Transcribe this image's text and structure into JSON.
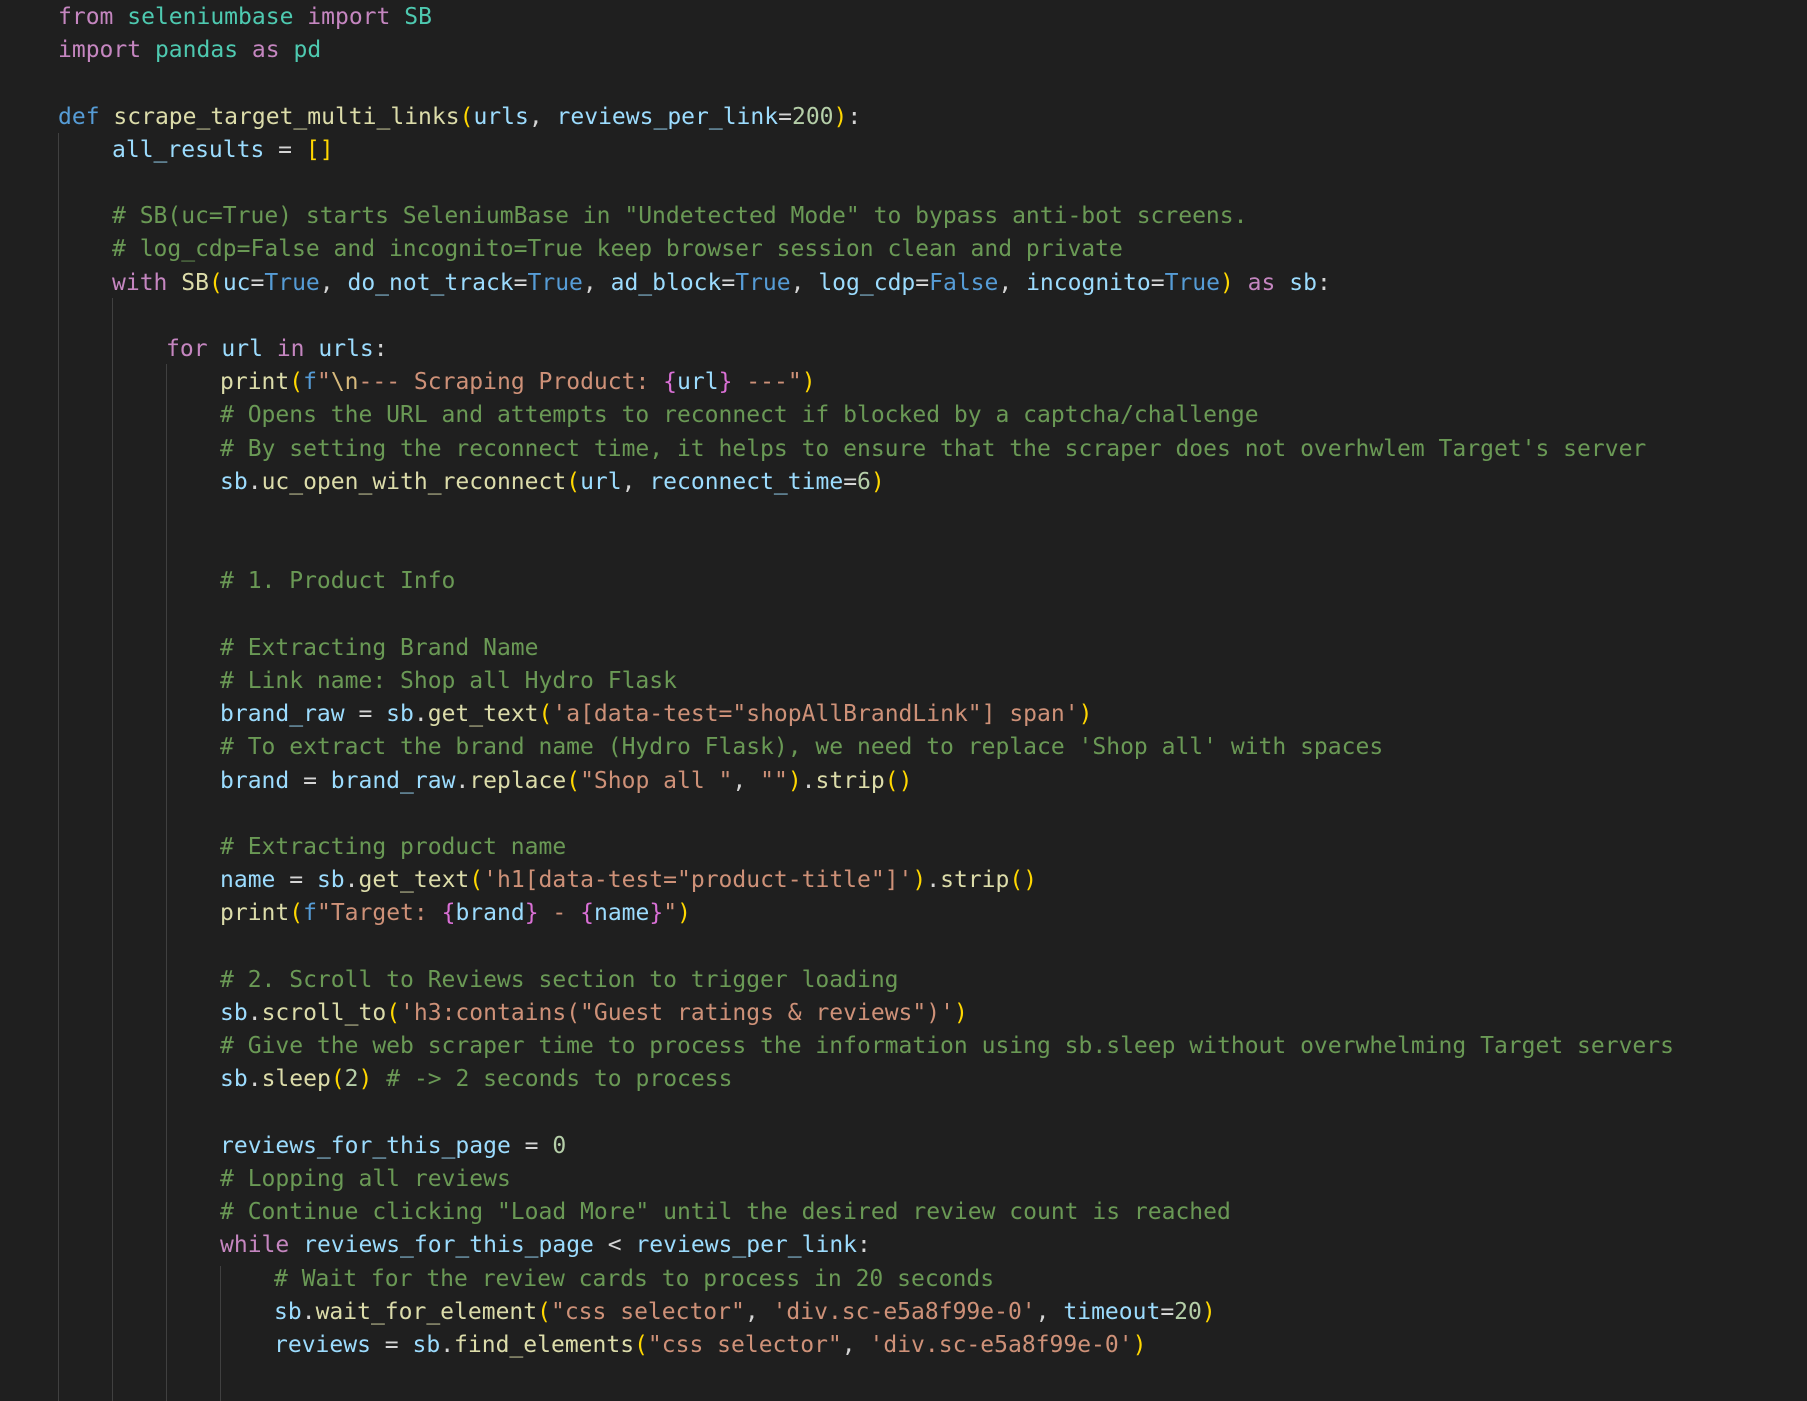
{
  "colors": {
    "background": "#1f1f1f",
    "keyword": "#c586c0",
    "storage": "#569cd6",
    "type": "#4ec9b0",
    "function": "#dcdcaa",
    "variable": "#9cdcfe",
    "string": "#ce9178",
    "number": "#b5cea8",
    "comment": "#6a9955",
    "operator": "#d4d4d4",
    "bracket_1": "#ffd700",
    "bracket_2": "#da70d6",
    "bracket_3": "#179fff",
    "escape": "#d7ba7d"
  },
  "code_lines": [
    {
      "indent": 0,
      "tokens": [
        [
          "kw",
          "from"
        ],
        [
          "op",
          " "
        ],
        [
          "cls",
          "seleniumbase"
        ],
        [
          "op",
          " "
        ],
        [
          "kw",
          "import"
        ],
        [
          "op",
          " "
        ],
        [
          "cls",
          "SB"
        ]
      ]
    },
    {
      "indent": 0,
      "tokens": [
        [
          "kw",
          "import"
        ],
        [
          "op",
          " "
        ],
        [
          "cls",
          "pandas"
        ],
        [
          "op",
          " "
        ],
        [
          "kw",
          "as"
        ],
        [
          "op",
          " "
        ],
        [
          "cls",
          "pd"
        ]
      ]
    },
    {
      "indent": 0,
      "tokens": []
    },
    {
      "indent": 0,
      "tokens": [
        [
          "def",
          "def"
        ],
        [
          "op",
          " "
        ],
        [
          "fn",
          "scrape_target_multi_links"
        ],
        [
          "b1",
          "("
        ],
        [
          "var",
          "urls"
        ],
        [
          "op",
          ", "
        ],
        [
          "var",
          "reviews_per_link"
        ],
        [
          "op",
          "="
        ],
        [
          "num",
          "200"
        ],
        [
          "b1",
          ")"
        ],
        [
          "op",
          ":"
        ]
      ]
    },
    {
      "indent": 1,
      "tokens": [
        [
          "var",
          "all_results"
        ],
        [
          "op",
          " = "
        ],
        [
          "b1",
          "[]"
        ]
      ]
    },
    {
      "indent": 0,
      "tokens": []
    },
    {
      "indent": 1,
      "tokens": [
        [
          "cmt",
          "# SB(uc=True) starts SeleniumBase in \"Undetected Mode\" to bypass anti-bot screens."
        ]
      ]
    },
    {
      "indent": 1,
      "tokens": [
        [
          "cmt",
          "# log_cdp=False and incognito=True keep browser session clean and private"
        ]
      ]
    },
    {
      "indent": 1,
      "tokens": [
        [
          "kw",
          "with"
        ],
        [
          "op",
          " "
        ],
        [
          "fn",
          "SB"
        ],
        [
          "b1",
          "("
        ],
        [
          "var",
          "uc"
        ],
        [
          "op",
          "="
        ],
        [
          "def",
          "True"
        ],
        [
          "op",
          ", "
        ],
        [
          "var",
          "do_not_track"
        ],
        [
          "op",
          "="
        ],
        [
          "def",
          "True"
        ],
        [
          "op",
          ", "
        ],
        [
          "var",
          "ad_block"
        ],
        [
          "op",
          "="
        ],
        [
          "def",
          "True"
        ],
        [
          "op",
          ", "
        ],
        [
          "var",
          "log_cdp"
        ],
        [
          "op",
          "="
        ],
        [
          "def",
          "False"
        ],
        [
          "op",
          ", "
        ],
        [
          "var",
          "incognito"
        ],
        [
          "op",
          "="
        ],
        [
          "def",
          "True"
        ],
        [
          "b1",
          ")"
        ],
        [
          "op",
          " "
        ],
        [
          "kw",
          "as"
        ],
        [
          "op",
          " "
        ],
        [
          "var",
          "sb"
        ],
        [
          "op",
          ":"
        ]
      ]
    },
    {
      "indent": 0,
      "tokens": []
    },
    {
      "indent": 2,
      "tokens": [
        [
          "kw",
          "for"
        ],
        [
          "op",
          " "
        ],
        [
          "var",
          "url"
        ],
        [
          "op",
          " "
        ],
        [
          "kw",
          "in"
        ],
        [
          "op",
          " "
        ],
        [
          "var",
          "urls"
        ],
        [
          "op",
          ":"
        ]
      ]
    },
    {
      "indent": 3,
      "tokens": [
        [
          "fn",
          "print"
        ],
        [
          "b1",
          "("
        ],
        [
          "def",
          "f"
        ],
        [
          "str",
          "\""
        ],
        [
          "esc",
          "\\n"
        ],
        [
          "str",
          "--- Scraping Product: "
        ],
        [
          "b2",
          "{"
        ],
        [
          "var",
          "url"
        ],
        [
          "b2",
          "}"
        ],
        [
          "str",
          " ---\""
        ],
        [
          "b1",
          ")"
        ]
      ]
    },
    {
      "indent": 3,
      "tokens": [
        [
          "cmt",
          "# Opens the URL and attempts to reconnect if blocked by a captcha/challenge"
        ]
      ]
    },
    {
      "indent": 3,
      "tokens": [
        [
          "cmt",
          "# By setting the reconnect time, it helps to ensure that the scraper does not overhwlem Target's server"
        ]
      ]
    },
    {
      "indent": 3,
      "tokens": [
        [
          "var",
          "sb"
        ],
        [
          "op",
          "."
        ],
        [
          "fn",
          "uc_open_with_reconnect"
        ],
        [
          "b1",
          "("
        ],
        [
          "var",
          "url"
        ],
        [
          "op",
          ", "
        ],
        [
          "var",
          "reconnect_time"
        ],
        [
          "op",
          "="
        ],
        [
          "num",
          "6"
        ],
        [
          "b1",
          ")"
        ]
      ]
    },
    {
      "indent": 0,
      "tokens": []
    },
    {
      "indent": 0,
      "tokens": []
    },
    {
      "indent": 3,
      "tokens": [
        [
          "cmt",
          "# 1. Product Info"
        ]
      ]
    },
    {
      "indent": 0,
      "tokens": []
    },
    {
      "indent": 3,
      "tokens": [
        [
          "cmt",
          "# Extracting Brand Name"
        ]
      ]
    },
    {
      "indent": 3,
      "tokens": [
        [
          "cmt",
          "# Link name: Shop all Hydro Flask"
        ]
      ]
    },
    {
      "indent": 3,
      "tokens": [
        [
          "var",
          "brand_raw"
        ],
        [
          "op",
          " = "
        ],
        [
          "var",
          "sb"
        ],
        [
          "op",
          "."
        ],
        [
          "fn",
          "get_text"
        ],
        [
          "b1",
          "("
        ],
        [
          "str",
          "'a[data-test=\"shopAllBrandLink\"] span'"
        ],
        [
          "b1",
          ")"
        ]
      ]
    },
    {
      "indent": 3,
      "tokens": [
        [
          "cmt",
          "# To extract the brand name (Hydro Flask), we need to replace 'Shop all' with spaces"
        ]
      ]
    },
    {
      "indent": 3,
      "tokens": [
        [
          "var",
          "brand"
        ],
        [
          "op",
          " = "
        ],
        [
          "var",
          "brand_raw"
        ],
        [
          "op",
          "."
        ],
        [
          "fn",
          "replace"
        ],
        [
          "b1",
          "("
        ],
        [
          "str",
          "\"Shop all \""
        ],
        [
          "op",
          ", "
        ],
        [
          "str",
          "\"\""
        ],
        [
          "b1",
          ")"
        ],
        [
          "op",
          "."
        ],
        [
          "fn",
          "strip"
        ],
        [
          "b1",
          "()"
        ]
      ]
    },
    {
      "indent": 0,
      "tokens": []
    },
    {
      "indent": 3,
      "tokens": [
        [
          "cmt",
          "# Extracting product name"
        ]
      ]
    },
    {
      "indent": 3,
      "tokens": [
        [
          "var",
          "name"
        ],
        [
          "op",
          " = "
        ],
        [
          "var",
          "sb"
        ],
        [
          "op",
          "."
        ],
        [
          "fn",
          "get_text"
        ],
        [
          "b1",
          "("
        ],
        [
          "str",
          "'h1[data-test=\"product-title\"]'"
        ],
        [
          "b1",
          ")"
        ],
        [
          "op",
          "."
        ],
        [
          "fn",
          "strip"
        ],
        [
          "b1",
          "()"
        ]
      ]
    },
    {
      "indent": 3,
      "tokens": [
        [
          "fn",
          "print"
        ],
        [
          "b1",
          "("
        ],
        [
          "def",
          "f"
        ],
        [
          "str",
          "\"Target: "
        ],
        [
          "b2",
          "{"
        ],
        [
          "var",
          "brand"
        ],
        [
          "b2",
          "}"
        ],
        [
          "str",
          " - "
        ],
        [
          "b2",
          "{"
        ],
        [
          "var",
          "name"
        ],
        [
          "b2",
          "}"
        ],
        [
          "str",
          "\""
        ],
        [
          "b1",
          ")"
        ]
      ]
    },
    {
      "indent": 0,
      "tokens": []
    },
    {
      "indent": 3,
      "tokens": [
        [
          "cmt",
          "# 2. Scroll to Reviews section to trigger loading"
        ]
      ]
    },
    {
      "indent": 3,
      "tokens": [
        [
          "var",
          "sb"
        ],
        [
          "op",
          "."
        ],
        [
          "fn",
          "scroll_to"
        ],
        [
          "b1",
          "("
        ],
        [
          "str",
          "'h3:contains(\"Guest ratings & reviews\")'"
        ],
        [
          "b1",
          ")"
        ]
      ]
    },
    {
      "indent": 3,
      "tokens": [
        [
          "cmt",
          "# Give the web scraper time to process the information using sb.sleep without overwhelming Target servers"
        ]
      ]
    },
    {
      "indent": 3,
      "tokens": [
        [
          "var",
          "sb"
        ],
        [
          "op",
          "."
        ],
        [
          "fn",
          "sleep"
        ],
        [
          "b1",
          "("
        ],
        [
          "num",
          "2"
        ],
        [
          "b1",
          ")"
        ],
        [
          "op",
          " "
        ],
        [
          "cmt",
          "# -> 2 seconds to process"
        ]
      ]
    },
    {
      "indent": 0,
      "tokens": []
    },
    {
      "indent": 3,
      "tokens": [
        [
          "var",
          "reviews_for_this_page"
        ],
        [
          "op",
          " = "
        ],
        [
          "num",
          "0"
        ]
      ]
    },
    {
      "indent": 3,
      "tokens": [
        [
          "cmt",
          "# Lopping all reviews"
        ]
      ]
    },
    {
      "indent": 3,
      "tokens": [
        [
          "cmt",
          "# Continue clicking \"Load More\" until the desired review count is reached"
        ]
      ]
    },
    {
      "indent": 3,
      "tokens": [
        [
          "kw",
          "while"
        ],
        [
          "op",
          " "
        ],
        [
          "var",
          "reviews_for_this_page"
        ],
        [
          "op",
          " < "
        ],
        [
          "var",
          "reviews_per_link"
        ],
        [
          "op",
          ":"
        ]
      ]
    },
    {
      "indent": 4,
      "tokens": [
        [
          "cmt",
          "# Wait for the review cards to process in 20 seconds"
        ]
      ]
    },
    {
      "indent": 4,
      "tokens": [
        [
          "var",
          "sb"
        ],
        [
          "op",
          "."
        ],
        [
          "fn",
          "wait_for_element"
        ],
        [
          "b1",
          "("
        ],
        [
          "str",
          "\"css selector\""
        ],
        [
          "op",
          ", "
        ],
        [
          "str",
          "'div.sc-e5a8f99e-0'"
        ],
        [
          "op",
          ", "
        ],
        [
          "var",
          "timeout"
        ],
        [
          "op",
          "="
        ],
        [
          "num",
          "20"
        ],
        [
          "b1",
          ")"
        ]
      ]
    },
    {
      "indent": 4,
      "tokens": [
        [
          "var",
          "reviews"
        ],
        [
          "op",
          " = "
        ],
        [
          "var",
          "sb"
        ],
        [
          "op",
          "."
        ],
        [
          "fn",
          "find_elements"
        ],
        [
          "b1",
          "("
        ],
        [
          "str",
          "\"css selector\""
        ],
        [
          "op",
          ", "
        ],
        [
          "str",
          "'div.sc-e5a8f99e-0'"
        ],
        [
          "b1",
          ")"
        ]
      ]
    },
    {
      "indent": 0,
      "tokens": []
    }
  ]
}
